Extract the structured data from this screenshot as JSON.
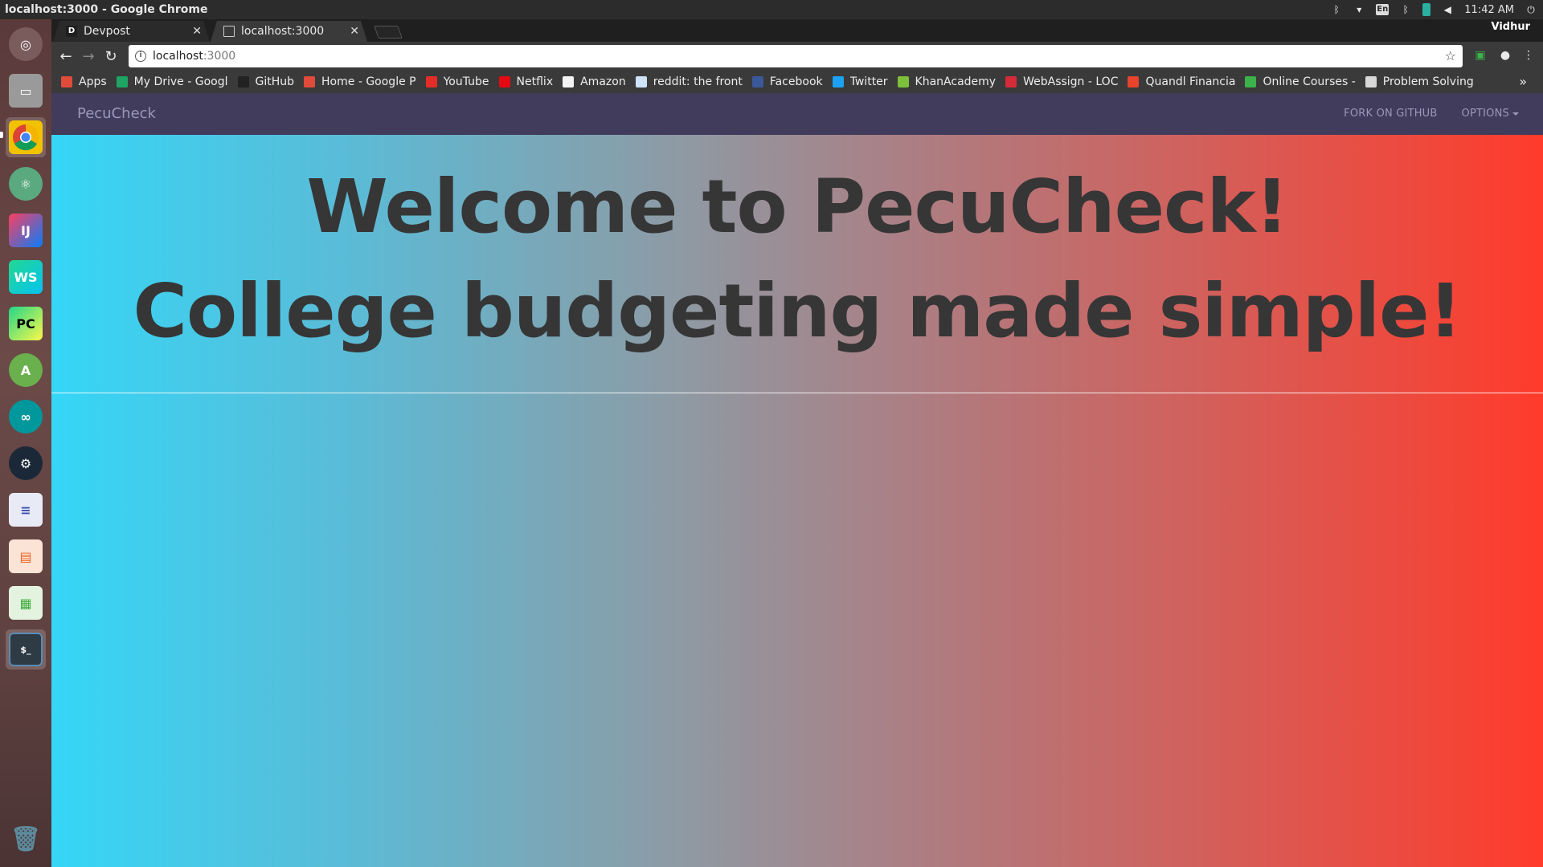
{
  "os": {
    "window_title": "localhost:3000 - Google Chrome",
    "clock": "11:42 AM",
    "user": "Vidhur",
    "lang": "En"
  },
  "browser": {
    "tabs": [
      {
        "label": "Devpost",
        "favicon": "D"
      },
      {
        "label": "localhost:3000",
        "favicon": "page-icon"
      }
    ],
    "url_host": "localhost",
    "url_port": ":3000",
    "bookmarks": [
      {
        "label": "Apps",
        "icon": "apps-grid-icon",
        "color": "#e04b3a"
      },
      {
        "label": "My Drive - Googl",
        "icon": "drive-icon",
        "color": "#1fa463"
      },
      {
        "label": "GitHub",
        "icon": "github-icon",
        "color": "#222222"
      },
      {
        "label": "Home - Google P",
        "icon": "google-plus-icon",
        "color": "#e04b3a"
      },
      {
        "label": "YouTube",
        "icon": "youtube-icon",
        "color": "#e52d27"
      },
      {
        "label": "Netflix",
        "icon": "netflix-icon",
        "color": "#e50914"
      },
      {
        "label": "Amazon",
        "icon": "amazon-icon",
        "color": "#f3f3f3"
      },
      {
        "label": "reddit: the front",
        "icon": "reddit-icon",
        "color": "#cee3f8"
      },
      {
        "label": "Facebook",
        "icon": "facebook-icon",
        "color": "#3b5998"
      },
      {
        "label": "Twitter",
        "icon": "twitter-icon",
        "color": "#1da1f2"
      },
      {
        "label": "KhanAcademy",
        "icon": "khan-icon",
        "color": "#7cbf3b"
      },
      {
        "label": "WebAssign - LOC",
        "icon": "webassign-icon",
        "color": "#d62b3a"
      },
      {
        "label": "Quandl Financia",
        "icon": "quandl-icon",
        "color": "#e8432d"
      },
      {
        "label": "Online Courses -",
        "icon": "udemy-icon",
        "color": "#3bb34a"
      },
      {
        "label": "Problem Solving",
        "icon": "page-icon",
        "color": "#d8d8d8"
      }
    ]
  },
  "app": {
    "brand": "PecuCheck",
    "nav": {
      "fork": "FORK ON GITHUB",
      "options": "OPTIONS"
    },
    "hero": {
      "line1": "Welcome to PecuCheck!",
      "line2": "College budgeting made simple!"
    },
    "gradient": {
      "left": "#35d6f7",
      "right": "#ff3b2b"
    },
    "navbar_color": "#413b5c"
  }
}
